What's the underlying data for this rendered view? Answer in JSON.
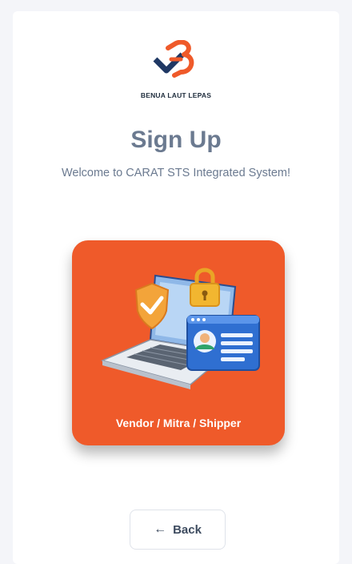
{
  "brand": {
    "name": "BENUA LAUT LEPAS",
    "colors": {
      "navy": "#1f3864",
      "orange": "#ef5a2a"
    }
  },
  "header": {
    "title": "Sign Up",
    "subtitle": "Welcome to CARAT STS Integrated System!"
  },
  "options": [
    {
      "label": "Vendor / Mitra / Shipper",
      "icon": "laptop-security-illustration",
      "color": "#ef5a2a"
    }
  ],
  "footer": {
    "back_label": "Back",
    "back_icon": "arrow-left-icon"
  }
}
